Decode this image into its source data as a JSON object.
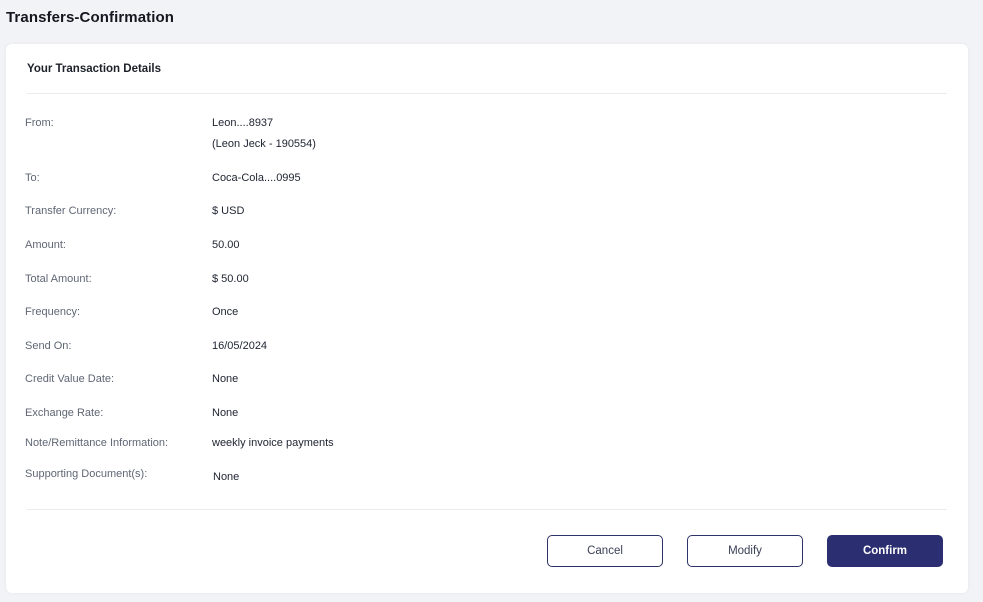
{
  "page": {
    "title": "Transfers-Confirmation"
  },
  "details": {
    "section_title": "Your Transaction Details",
    "from": {
      "label": "From:",
      "account": "Leon....8937",
      "holder": "(Leon Jeck - 190554)"
    },
    "to": {
      "label": "To:",
      "value": "Coca-Cola....0995"
    },
    "transfer_currency": {
      "label": "Transfer Currency:",
      "value": "$ USD"
    },
    "amount": {
      "label": "Amount:",
      "value": "50.00"
    },
    "total_amount": {
      "label": "Total Amount:",
      "value": "$ 50.00"
    },
    "frequency": {
      "label": "Frequency:",
      "value": "Once"
    },
    "send_on": {
      "label": "Send On:",
      "value": "16/05/2024"
    },
    "credit_value_date": {
      "label": "Credit Value Date:",
      "value": "None"
    },
    "exchange_rate": {
      "label": "Exchange Rate:",
      "value": "None"
    },
    "note": {
      "label": "Note/Remittance Information:",
      "value": "weekly invoice payments"
    },
    "supporting_documents": {
      "label": "Supporting Document(s):",
      "value": "None"
    }
  },
  "actions": {
    "cancel_label": "Cancel",
    "modify_label": "Modify",
    "confirm_label": "Confirm"
  },
  "colors": {
    "primary": "#2b2f72",
    "background": "#f2f3f7",
    "card": "#ffffff",
    "label_text": "#5f6674"
  }
}
